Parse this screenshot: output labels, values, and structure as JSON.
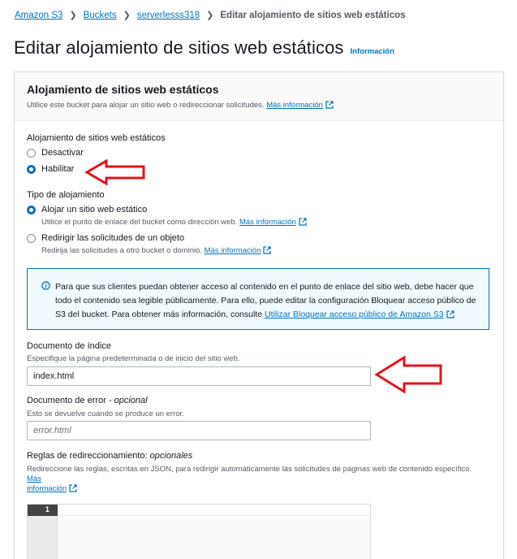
{
  "breadcrumb": {
    "items": [
      "Amazon S3",
      "Buckets",
      "serverlesss318"
    ],
    "current": "Editar alojamiento de sitios web estáticos"
  },
  "page": {
    "title": "Editar alojamiento de sitios web estáticos",
    "info_label": "Información"
  },
  "panel": {
    "title": "Alojamiento de sitios web estáticos",
    "description": "Utilice este bucket para alojar un sitio web o redireccionar solicitudes.",
    "more_info": "Más información"
  },
  "hosting": {
    "label": "Alojamiento de sitios web estáticos",
    "options": [
      {
        "label": "Desactivar",
        "selected": false
      },
      {
        "label": "Habilitar",
        "selected": true
      }
    ]
  },
  "hosting_type": {
    "label": "Tipo de alojamiento",
    "options": [
      {
        "label": "Alojar un sitio web estático",
        "hint": "Utilice el punto de enlace del bucket como dirección web.",
        "more_info": "Más información",
        "selected": true
      },
      {
        "label": "Redirigir las solicitudes de un objeto",
        "hint": "Redirija las solicitudes a otro bucket o dominio.",
        "more_info": "Más información",
        "selected": false
      }
    ]
  },
  "alert": {
    "line1": "Para que sus clientes puedan obtener acceso al contenido en el punto de enlace del sitio web, debe hacer que",
    "line2": "todo el contenido sea legible públicamente. Para ello, puede editar la configuración Bloquear acceso público de",
    "line3": "S3 del bucket. Para obtener más información, consulte",
    "link": "Utilizar Bloquear acceso público de Amazon S3"
  },
  "index_document": {
    "label": "Documento de índice",
    "hint": "Especifique la página predeterminada o de inicio del sitio web.",
    "value": "index.html"
  },
  "error_document": {
    "label": "Documento de error",
    "optional": "opcional",
    "hint": "Esto se devuelve cuando se produce un error.",
    "placeholder": "error.html"
  },
  "redirect_rules": {
    "label": "Reglas de redireccionamiento:",
    "optional": "opcionales",
    "hint": "Redireccione las reglas, escritas en JSON, para redirigir automáticamente las solicitudes de páginas web de contenido específico.",
    "more_info_1": "Más",
    "more_info_2": "información",
    "line_number": "1"
  },
  "colors": {
    "link": "#0073bb",
    "annotation_arrow": "#e3141b"
  }
}
